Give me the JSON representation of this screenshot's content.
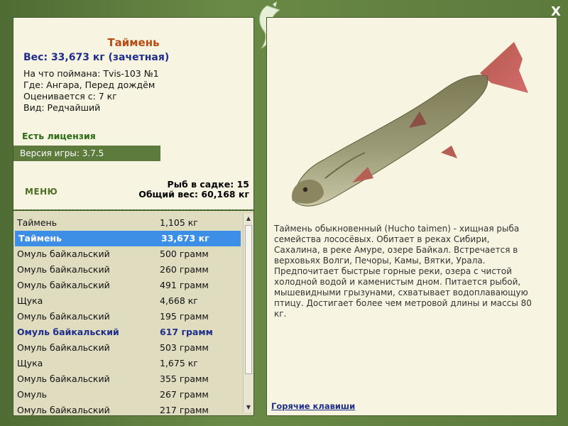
{
  "close_label": "X",
  "fish": {
    "title": "Таймень",
    "weight": "Вес: 33,673 кг (зачетная)",
    "where_caught": "На что поймана: Tvis-103 №1",
    "location": "Где: Ангара, Перед дождём",
    "valued": "Оценивается с: 7 кг",
    "kind": "Вид: Редчайший"
  },
  "license": "Есть лицензия",
  "version": "Версия игры: 3.7.5",
  "menu_label": "МЕНЮ",
  "stats": {
    "count": "Рыб в садке: 15",
    "total": "Общий вес: 60,168 кг"
  },
  "rows": [
    {
      "name": "Таймень",
      "weight": "1,105 кг"
    },
    {
      "name": "Таймень",
      "weight": "33,673 кг"
    },
    {
      "name": "Омуль байкальский",
      "weight": "500 грамм"
    },
    {
      "name": "Омуль байкальский",
      "weight": "260 грамм"
    },
    {
      "name": "Омуль байкальский",
      "weight": "491 грамм"
    },
    {
      "name": "Щука",
      "weight": "4,668 кг"
    },
    {
      "name": "Омуль байкальский",
      "weight": "195 грамм"
    },
    {
      "name": "Омуль байкальский",
      "weight": "617 грамм"
    },
    {
      "name": "Омуль байкальский",
      "weight": "503 грамм"
    },
    {
      "name": "Щука",
      "weight": "1,675 кг"
    },
    {
      "name": "Омуль байкальский",
      "weight": "355 грамм"
    },
    {
      "name": "Омуль",
      "weight": "267 грамм"
    },
    {
      "name": "Омуль байкальский",
      "weight": "217 грамм"
    }
  ],
  "description": "Таймень обыкновенный (Hucho taimen) - хищная рыба семейства лососёвых. Обитает в реках Сибири, Сахалина, в реке Амуре, озере Байкал. Встречается в верховьях Волги, Печоры, Камы, Вятки, Урала. Предпочитает быстрые горные реки, озера с чистой холодной водой и каменистым дном. Питается рыбой, мышевидными грызунами, схватывает водоплавающую птицу. Достигает более чем метровой длины и массы 80 кг.",
  "hotkeys": "Горячие клавиши"
}
